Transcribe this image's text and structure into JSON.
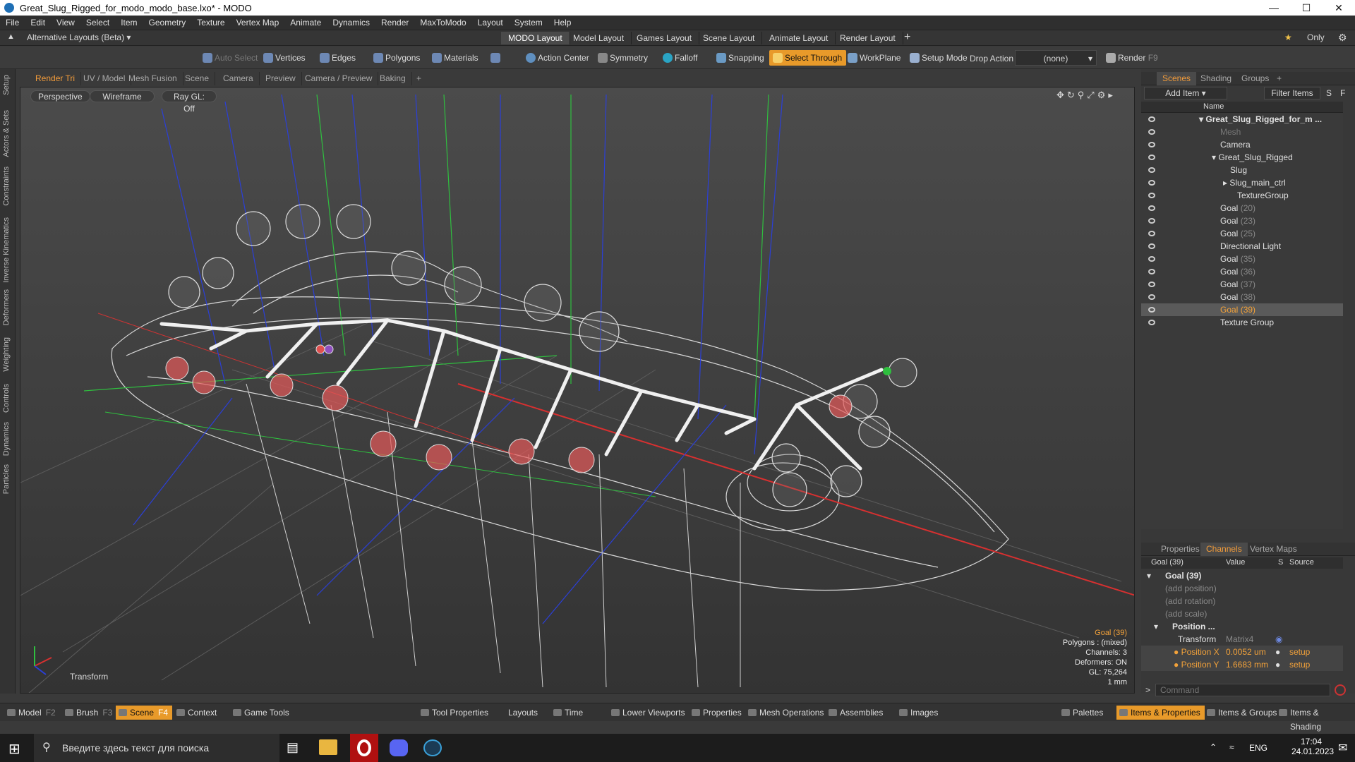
{
  "window": {
    "title": "Great_Slug_Rigged_for_modo_modo_base.lxo* - MODO"
  },
  "menu": [
    "File",
    "Edit",
    "View",
    "Select",
    "Item",
    "Geometry",
    "Texture",
    "Vertex Map",
    "Animate",
    "Dynamics",
    "Render",
    "MaxToModo",
    "Layout",
    "System",
    "Help"
  ],
  "layouts": {
    "dropdown": "Alternative Layouts (Beta)",
    "tabs": [
      "MODO Layout",
      "Model Layout",
      "Games Layout",
      "Scene Layout",
      "Animate Layout",
      "Render Layout"
    ],
    "add": "+",
    "only": "Only"
  },
  "toolbar": {
    "auto_select": "Auto Select",
    "vertices": "Vertices",
    "edges": "Edges",
    "polygons": "Polygons",
    "materials": "Materials",
    "action_center": "Action Center",
    "symmetry": "Symmetry",
    "falloff": "Falloff",
    "snapping": "Snapping",
    "select_through": "Select Through",
    "workplane": "WorkPlane",
    "setup_mode": "Setup Mode",
    "drop_action": "Drop Action",
    "none": "(none)",
    "render": "Render",
    "render_key": "F9"
  },
  "left_rail": [
    "Setup",
    "Actors & Sets",
    "Constraints",
    "Inverse Kinematics",
    "Deformers",
    "Weighting",
    "Controls",
    "Dynamics",
    "Particles"
  ],
  "viewport": {
    "tabs": [
      "Render Tri",
      "UV / Model",
      "Mesh Fusion",
      "Scene",
      "Camera",
      "Preview",
      "Camera / Preview",
      "Baking"
    ],
    "view": "Perspective",
    "shading": "Wireframe",
    "raygl": "Ray GL: Off",
    "tool_label": "Transform",
    "hud": {
      "selected": "Goal (39)",
      "polygons": "Polygons : (mixed)",
      "channels": "Channels: 3",
      "deformers": "Deformers: ON",
      "gl": "GL: 75,264",
      "scale": "1 mm"
    }
  },
  "scenes_panel": {
    "tabs": [
      "Scenes",
      "Shading",
      "Groups"
    ],
    "add_item": "Add Item",
    "filter": "Filter Items",
    "s": "S",
    "f": "F",
    "col_name": "Name",
    "items": [
      {
        "label": "Great_Slug_Rigged_for_m ...",
        "num": "",
        "indent": 0
      },
      {
        "label": "Mesh",
        "num": "",
        "indent": 1
      },
      {
        "label": "Camera",
        "num": "",
        "indent": 1
      },
      {
        "label": "Great_Slug_Rigged",
        "num": "",
        "indent": 1
      },
      {
        "label": "Slug",
        "num": "",
        "indent": 2
      },
      {
        "label": "Slug_main_ctrl",
        "num": "",
        "indent": 2
      },
      {
        "label": "TextureGroup",
        "num": "",
        "indent": 2
      },
      {
        "label": "Goal",
        "num": "(20)",
        "indent": 1
      },
      {
        "label": "Goal",
        "num": "(23)",
        "indent": 1
      },
      {
        "label": "Goal",
        "num": "(25)",
        "indent": 1
      },
      {
        "label": "Directional Light",
        "num": "",
        "indent": 1
      },
      {
        "label": "Goal",
        "num": "(35)",
        "indent": 1
      },
      {
        "label": "Goal",
        "num": "(36)",
        "indent": 1
      },
      {
        "label": "Goal",
        "num": "(37)",
        "indent": 1
      },
      {
        "label": "Goal",
        "num": "(38)",
        "indent": 1
      },
      {
        "label": "Goal",
        "num": "(39)",
        "indent": 1
      },
      {
        "label": "Texture Group",
        "num": "",
        "indent": 1
      }
    ]
  },
  "channels_panel": {
    "tabs": [
      "Properties",
      "Channels",
      "Vertex Maps"
    ],
    "header": {
      "name": "Goal (39)",
      "value": "Value",
      "s": "S",
      "source": "Source"
    },
    "root": "Goal (39)",
    "add_position": "(add position)",
    "add_rotation": "(add rotation)",
    "add_scale": "(add scale)",
    "position_group": "Position ...",
    "transform": {
      "label": "Transform",
      "value": "Matrix4"
    },
    "pos_x": {
      "label": "Position X",
      "value": "0.0052 um",
      "source": "setup"
    },
    "pos_y": {
      "label": "Position Y",
      "value": "1.6683 mm",
      "source": "setup"
    },
    "command_placeholder": "Command"
  },
  "statusbar": {
    "model": "Model",
    "model_key": "F2",
    "brush": "Brush",
    "brush_key": "F3",
    "scene": "Scene",
    "scene_key": "F4",
    "context": "Context",
    "game_tools": "Game Tools",
    "tool_properties": "Tool Properties",
    "layouts": "Layouts",
    "time": "Time",
    "lower_viewports": "Lower Viewports",
    "properties": "Properties",
    "mesh_operations": "Mesh Operations",
    "assemblies": "Assemblies",
    "images": "Images",
    "palettes": "Palettes",
    "items_properties": "Items & Properties",
    "items_groups": "Items & Groups",
    "items_shading": "Items & Shading"
  },
  "taskbar": {
    "search": "Введите здесь текст для поиска",
    "lang": "ENG",
    "time": "17:04",
    "date": "24.01.2023"
  },
  "colors": {
    "accent": "#e89a2a",
    "selection_text": "#f3a23a",
    "x_axis": "#d83030",
    "y_axis": "#2fbf3f",
    "z_axis": "#2b3fd8"
  }
}
